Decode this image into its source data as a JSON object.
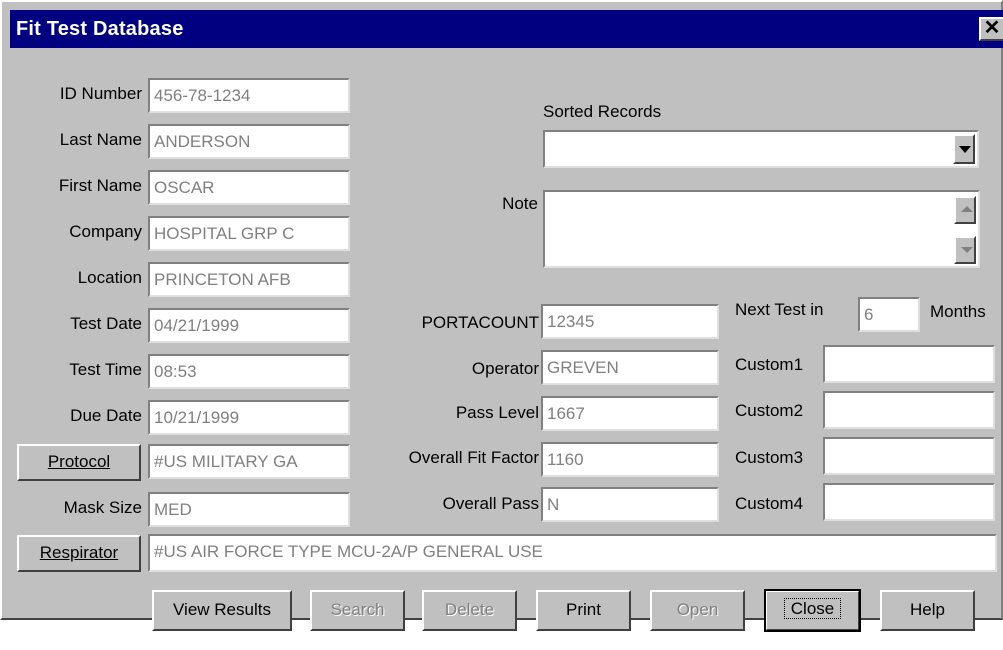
{
  "window": {
    "title": "Fit Test Database",
    "close_glyph": "✕"
  },
  "left_fields": [
    {
      "label": "ID Number",
      "value": "456-78-1234"
    },
    {
      "label": "Last Name",
      "value": "ANDERSON"
    },
    {
      "label": "First Name",
      "value": "OSCAR"
    },
    {
      "label": "Company",
      "value": "HOSPITAL GRP C"
    },
    {
      "label": "Location",
      "value": "PRINCETON AFB"
    },
    {
      "label": "Test Date",
      "value": "04/21/1999"
    },
    {
      "label": "Test Time",
      "value": "08:53"
    },
    {
      "label": "Due Date",
      "value": "10/21/1999"
    },
    {
      "label": "Protocol",
      "value": "#US MILITARY GA"
    },
    {
      "label": "Mask Size",
      "value": "MED"
    }
  ],
  "sorted_records": {
    "label": "Sorted Records",
    "value": ""
  },
  "note": {
    "label": "Note",
    "value": ""
  },
  "mid_fields": [
    {
      "label": "PORTACOUNT",
      "value": "12345"
    },
    {
      "label": "Operator",
      "value": "GREVEN"
    },
    {
      "label": "Pass Level",
      "value": "1667"
    },
    {
      "label": "Overall Fit Factor",
      "value": "1160"
    },
    {
      "label": "Overall Pass",
      "value": "N"
    }
  ],
  "next_test": {
    "label": "Next Test in",
    "value": "6",
    "unit": "Months"
  },
  "custom_fields": [
    {
      "label": "Custom1",
      "value": ""
    },
    {
      "label": "Custom2",
      "value": ""
    },
    {
      "label": "Custom3",
      "value": ""
    },
    {
      "label": "Custom4",
      "value": ""
    }
  ],
  "respirator": {
    "label": "Respirator",
    "value": "#US AIR FORCE TYPE MCU-2A/P GENERAL USE"
  },
  "buttons": {
    "view_results": "View Results",
    "search": "Search",
    "delete": "Delete",
    "print": "Print",
    "open": "Open",
    "close": "Close",
    "help": "Help"
  },
  "colors": {
    "titlebar": "#000080",
    "face": "#c0c0c0",
    "field_text": "#808080"
  }
}
